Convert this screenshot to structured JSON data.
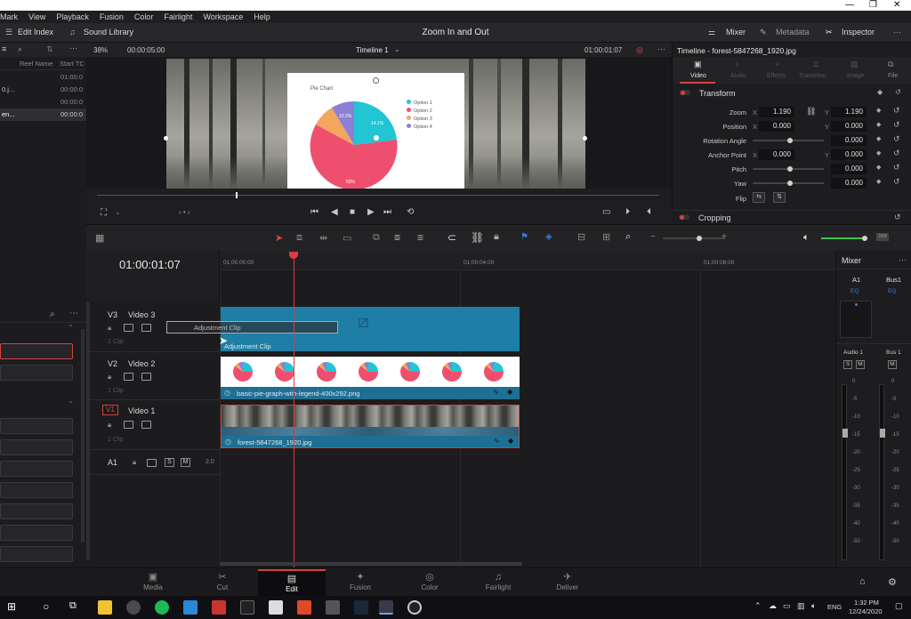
{
  "menubar": [
    "Mark",
    "View",
    "Playback",
    "Fusion",
    "Color",
    "Fairlight",
    "Workspace",
    "Help"
  ],
  "toolbar": {
    "edit_index": "Edit Index",
    "sound_library": "Sound Library",
    "project_title": "Zoom In and Out",
    "mixer": "Mixer",
    "metadata": "Metadata",
    "inspector": "Inspector"
  },
  "media_pool": {
    "col_reel": "Reel Name",
    "col_start": "Start TC",
    "rows": [
      {
        "name": "",
        "tc": "01:00:0"
      },
      {
        "name": "0.j...",
        "tc": "00:00:0"
      },
      {
        "name": "",
        "tc": "00:00:0"
      },
      {
        "name": "en...",
        "tc": "00:00:0"
      }
    ]
  },
  "viewer": {
    "zoom": "38%",
    "timecode_left": "00:00:05:00",
    "timeline_name": "Timeline 1",
    "timecode_right": "01:00:01:07",
    "overlay_title": "Pie Chart",
    "legend": [
      "Option 1",
      "Option 2",
      "Option 3",
      "Option 4"
    ],
    "slice_labels": [
      "14.1%",
      "10.3%",
      "50%"
    ]
  },
  "pie_colors": {
    "teal": "#22c5d4",
    "pink": "#ef4f6e",
    "orange": "#f2a65e",
    "purple": "#8b7fd6"
  },
  "inspector": {
    "title": "Timeline - forest-5847268_1920.jpg",
    "tabs": [
      "Video",
      "Audio",
      "Effects",
      "Transition",
      "Image",
      "File"
    ],
    "section_transform": "Transform",
    "section_cropping": "Cropping",
    "zoom_label": "Zoom",
    "zoom_x": "1.190",
    "zoom_y": "1.190",
    "position_label": "Position",
    "position_x": "0.000",
    "position_y": "0.000",
    "rotation_label": "Rotation Angle",
    "rotation_val": "0.000",
    "anchor_label": "Anchor Point",
    "anchor_x": "0.000",
    "anchor_y": "0.000",
    "pitch_label": "Pitch",
    "pitch_val": "0.000",
    "yaw_label": "Yaw",
    "yaw_val": "0.000",
    "flip_label": "Flip",
    "x": "X",
    "y": "Y"
  },
  "timeline": {
    "timecode": "01:00:01:07",
    "ruler": [
      "01:00:00:00",
      "01:00:04:00",
      "01:00:08:00"
    ],
    "tracks": [
      {
        "id": "V3",
        "name": "Video 3",
        "clips": "1 Clip",
        "clip_label": "Adjustment Clip"
      },
      {
        "id": "V2",
        "name": "Video 2",
        "clips": "1 Clip",
        "clip_label": "basic-pie-graph-with-legend-400x292.png"
      },
      {
        "id": "V1",
        "name": "Video 1",
        "clips": "1 Clip",
        "clip_label": "forest-5847268_1920.jpg"
      },
      {
        "id": "A1",
        "name": "",
        "clips": "",
        "clip_label": "2.0"
      }
    ],
    "drag_label": "Adjustment Clip"
  },
  "mixer": {
    "title": "Mixer",
    "a1": "A1",
    "bus1": "Bus1",
    "eq": "EQ",
    "audio1": "Audio 1",
    "bus1b": "Bus 1",
    "s": "S",
    "m": "M",
    "db_scale": [
      "0",
      "-5",
      "-10",
      "-15",
      "-20",
      "-25",
      "-30",
      "-35",
      "-40",
      "-50"
    ]
  },
  "pages": [
    "Media",
    "Cut",
    "Edit",
    "Fusion",
    "Color",
    "Fairlight",
    "Deliver"
  ],
  "active_page": "Edit",
  "taskbar": {
    "time": "1:32 PM",
    "date": "12/24/2020",
    "lang": "ENG"
  }
}
